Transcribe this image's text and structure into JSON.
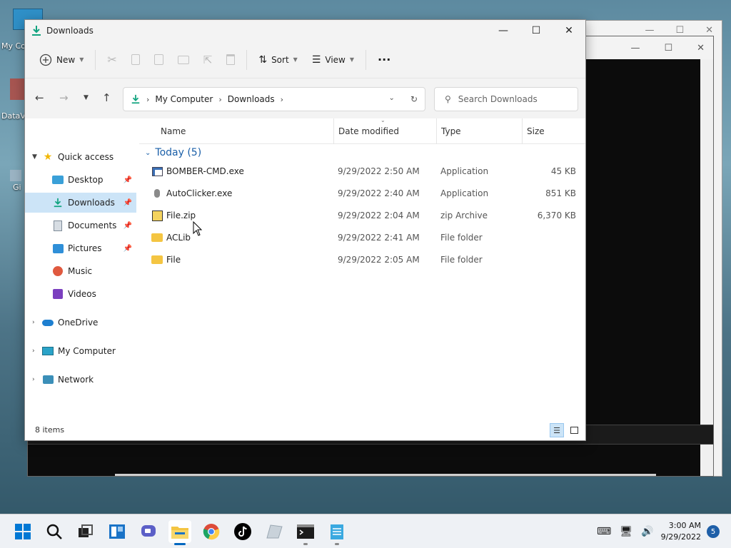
{
  "desktop": {
    "icons": [
      {
        "label": "My Co",
        "icon": "monitor-icon"
      },
      {
        "label": "DataV",
        "icon": "app-icon"
      },
      {
        "label": "Gi",
        "icon": "shortcut-icon"
      }
    ]
  },
  "explorer": {
    "title": "Downloads",
    "controls": {
      "minimize": "—",
      "maximize": "☐",
      "close": "✕"
    },
    "toolbar": {
      "new_label": "New",
      "sort_label": "Sort",
      "view_label": "View",
      "more_label": "···"
    },
    "address": {
      "segments": [
        "My Computer",
        "Downloads"
      ]
    },
    "search": {
      "placeholder": "Search Downloads"
    },
    "sidebar": {
      "quick_access": "Quick access",
      "items": [
        {
          "label": "Desktop",
          "icon": "desktop-icon",
          "pinned": true
        },
        {
          "label": "Downloads",
          "icon": "download-icon",
          "pinned": true,
          "selected": true
        },
        {
          "label": "Documents",
          "icon": "documents-icon",
          "pinned": true
        },
        {
          "label": "Pictures",
          "icon": "pictures-icon",
          "pinned": true
        },
        {
          "label": "Music",
          "icon": "music-icon",
          "pinned": false
        },
        {
          "label": "Videos",
          "icon": "videos-icon",
          "pinned": false
        }
      ],
      "roots": [
        {
          "label": "OneDrive",
          "icon": "onedrive-icon"
        },
        {
          "label": "My Computer",
          "icon": "computer-icon"
        },
        {
          "label": "Network",
          "icon": "network-icon"
        }
      ]
    },
    "columns": {
      "name": "Name",
      "date": "Date modified",
      "type": "Type",
      "size": "Size"
    },
    "group": {
      "label": "Today (5)"
    },
    "files": [
      {
        "name": "BOMBER-CMD.exe",
        "date": "9/29/2022 2:50 AM",
        "type": "Application",
        "size": "45 KB",
        "icon": "exe-icon"
      },
      {
        "name": "AutoClicker.exe",
        "date": "9/29/2022 2:40 AM",
        "type": "Application",
        "size": "851 KB",
        "icon": "mouse-icon"
      },
      {
        "name": "File.zip",
        "date": "9/29/2022 2:04 AM",
        "type": "zip Archive",
        "size": "6,370 KB",
        "icon": "zip-icon"
      },
      {
        "name": "ACLib",
        "date": "9/29/2022 2:41 AM",
        "type": "File folder",
        "size": "",
        "icon": "folder-icon"
      },
      {
        "name": "File",
        "date": "9/29/2022 2:05 AM",
        "type": "File folder",
        "size": "",
        "icon": "folder-icon"
      }
    ],
    "status": {
      "count": "8 items"
    }
  },
  "taskbar": {
    "apps": [
      "start",
      "search",
      "task-view",
      "widgets",
      "chat",
      "file-explorer",
      "chrome",
      "tiktok",
      "app",
      "terminal",
      "notepad"
    ],
    "clock": {
      "time": "3:00 AM",
      "date": "9/29/2022"
    },
    "notifications": "5"
  },
  "colors": {
    "accent": "#0067c0",
    "selection": "#cce4f7",
    "folder": "#f4c542"
  }
}
